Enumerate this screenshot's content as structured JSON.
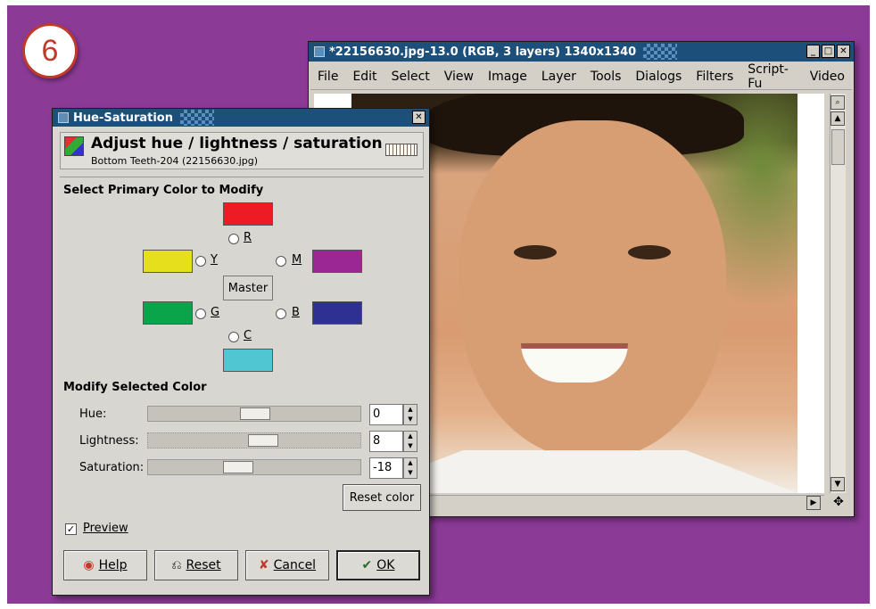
{
  "step_number": "6",
  "image_window": {
    "title": "*22156630.jpg-13.0 (RGB, 3 layers) 1340x1340",
    "menu": [
      "File",
      "Edit",
      "Select",
      "View",
      "Image",
      "Layer",
      "Tools",
      "Dialogs",
      "Filters",
      "Script-Fu",
      "Video"
    ]
  },
  "dialog": {
    "title": "Hue-Saturation",
    "header_title": "Adjust hue / lightness / saturation",
    "header_subtitle": "Bottom Teeth-204 (22156630.jpg)",
    "select_section": "Select Primary Color to Modify",
    "colors": {
      "R": {
        "label": "R",
        "hex": "#ed1c24"
      },
      "Y": {
        "label": "Y",
        "hex": "#e6e01c"
      },
      "M": {
        "label": "M",
        "hex": "#9b2794"
      },
      "G": {
        "label": "G",
        "hex": "#0aa54b"
      },
      "B": {
        "label": "B",
        "hex": "#2e3192"
      },
      "C": {
        "label": "C",
        "hex": "#4fc6d2"
      }
    },
    "master_label": "Master",
    "modify_section": "Modify Selected Color",
    "hue": {
      "label": "Hue:",
      "value": "0"
    },
    "lightness": {
      "label": "Lightness:",
      "value": "8"
    },
    "saturation": {
      "label": "Saturation:",
      "value": "-18"
    },
    "reset_color": "Reset color",
    "preview_label": "Preview",
    "preview_checked": true,
    "buttons": {
      "help": "Help",
      "reset": "Reset",
      "cancel": "Cancel",
      "ok": "OK"
    }
  }
}
